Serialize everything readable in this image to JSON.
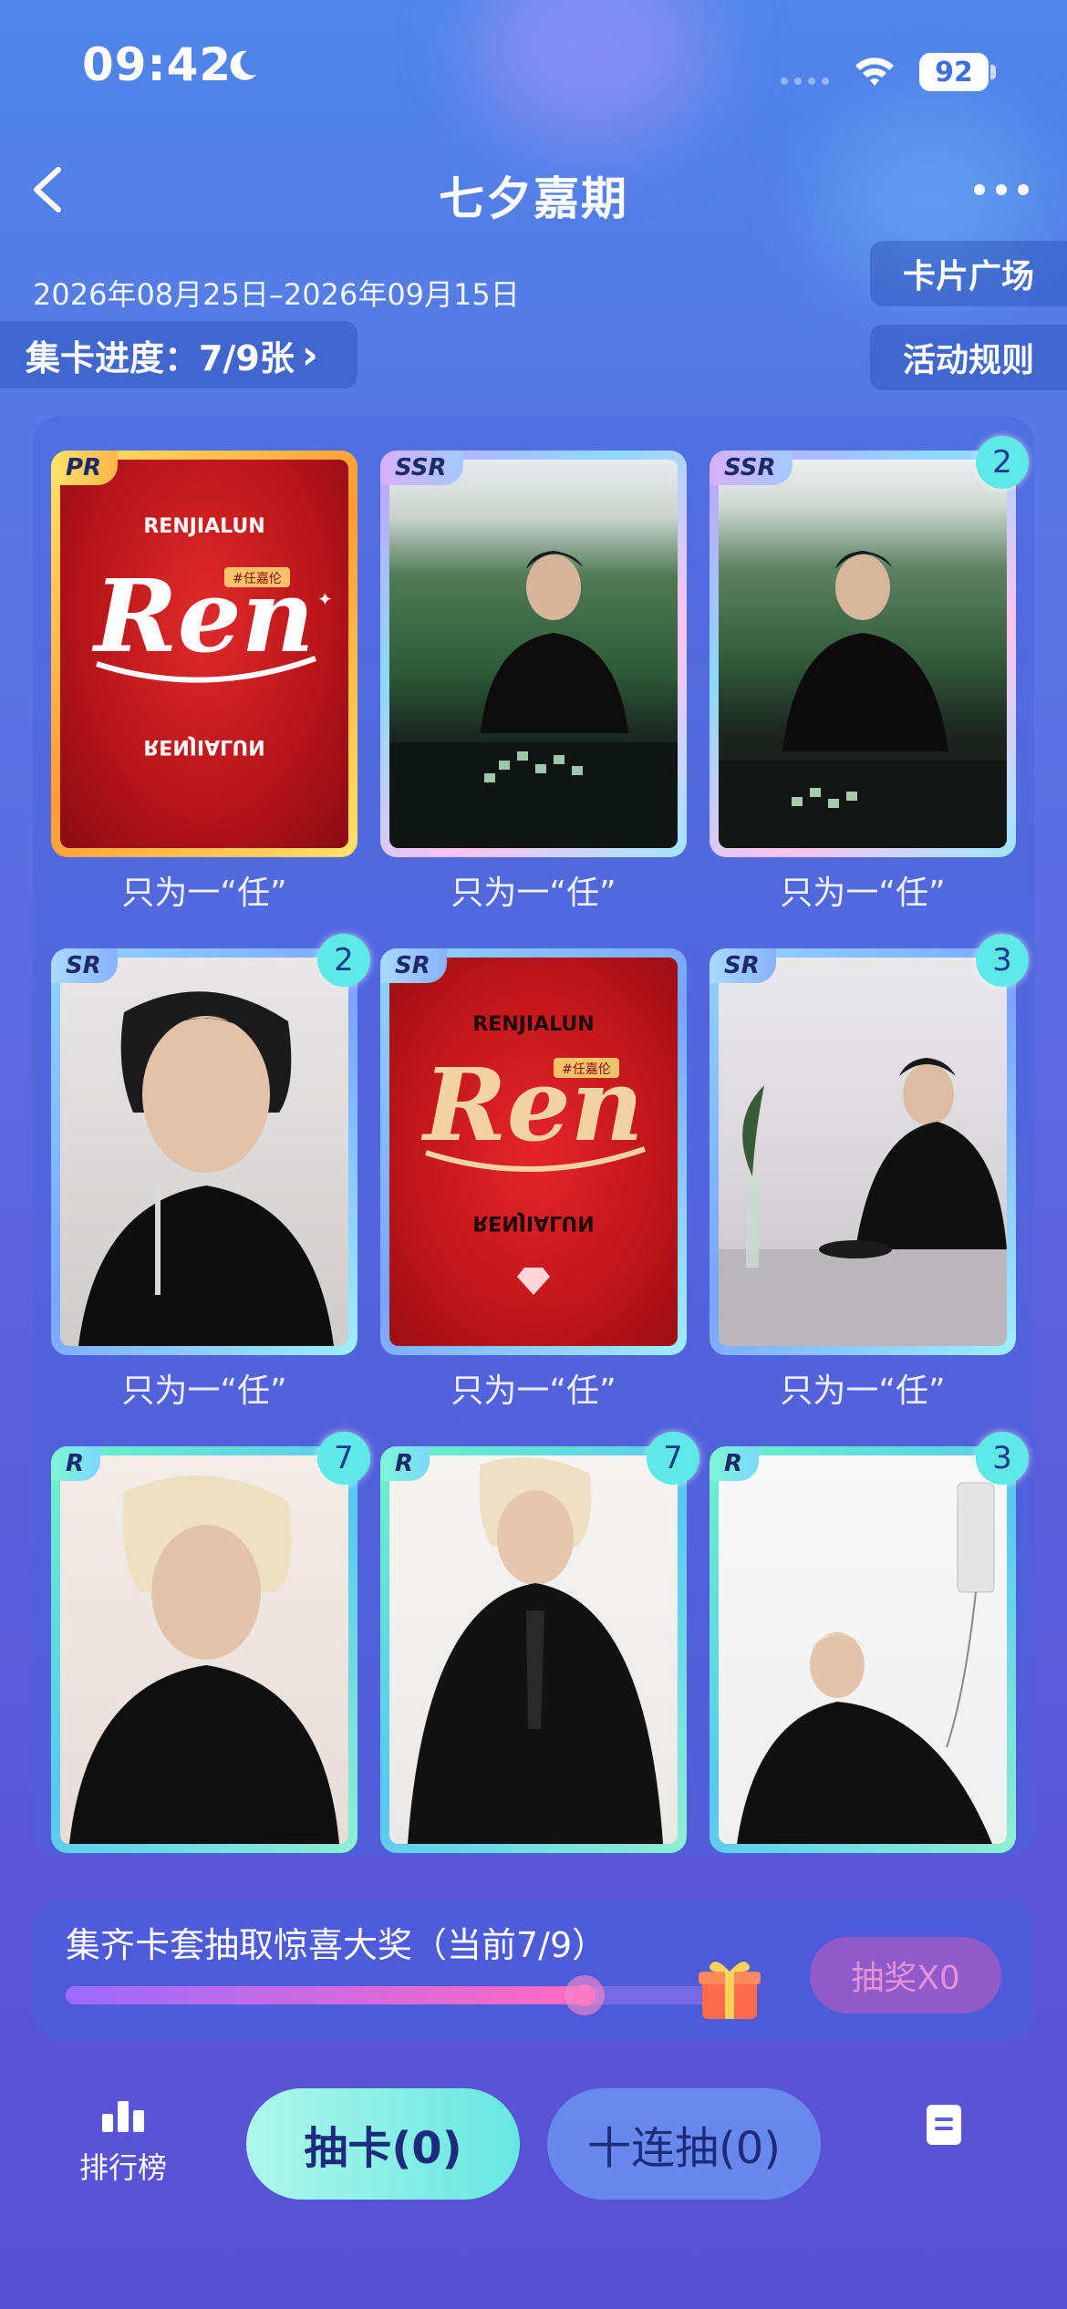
{
  "status_bar": {
    "time": "09:42",
    "battery": "92"
  },
  "header": {
    "title": "七夕嘉期"
  },
  "event": {
    "dates": "2026年08月25日–2026年09月15日",
    "card_plaza": "卡片广场",
    "rules": "活动规则",
    "progress_label": "集卡进度：7/9张",
    "chevron": "›"
  },
  "cards": [
    {
      "rarity": "PR",
      "count": "",
      "caption": "只为一“任”"
    },
    {
      "rarity": "SSR",
      "count": "",
      "caption": "只为一“任”"
    },
    {
      "rarity": "SSR",
      "count": "2",
      "caption": "只为一“任”"
    },
    {
      "rarity": "SR",
      "count": "2",
      "caption": "只为一“任”"
    },
    {
      "rarity": "SR",
      "count": "",
      "caption": "只为一“任”"
    },
    {
      "rarity": "SR",
      "count": "3",
      "caption": "只为一“任”"
    },
    {
      "rarity": "R",
      "count": "7",
      "caption": ""
    },
    {
      "rarity": "R",
      "count": "7",
      "caption": ""
    },
    {
      "rarity": "R",
      "count": "3",
      "caption": ""
    }
  ],
  "logo_text": {
    "top": "RENJIALUN",
    "main": "Ren",
    "tag": "#任嘉伦"
  },
  "collect": {
    "text": "集齐卡套抽取惊喜大奖（当前7/9）",
    "progress": 0.78,
    "lottery_button": "抽奖X0"
  },
  "bottom_bar": {
    "rank_label": "排行榜",
    "draw_button": "抽卡(0)",
    "ten_draw_button": "十连抽(0)"
  }
}
